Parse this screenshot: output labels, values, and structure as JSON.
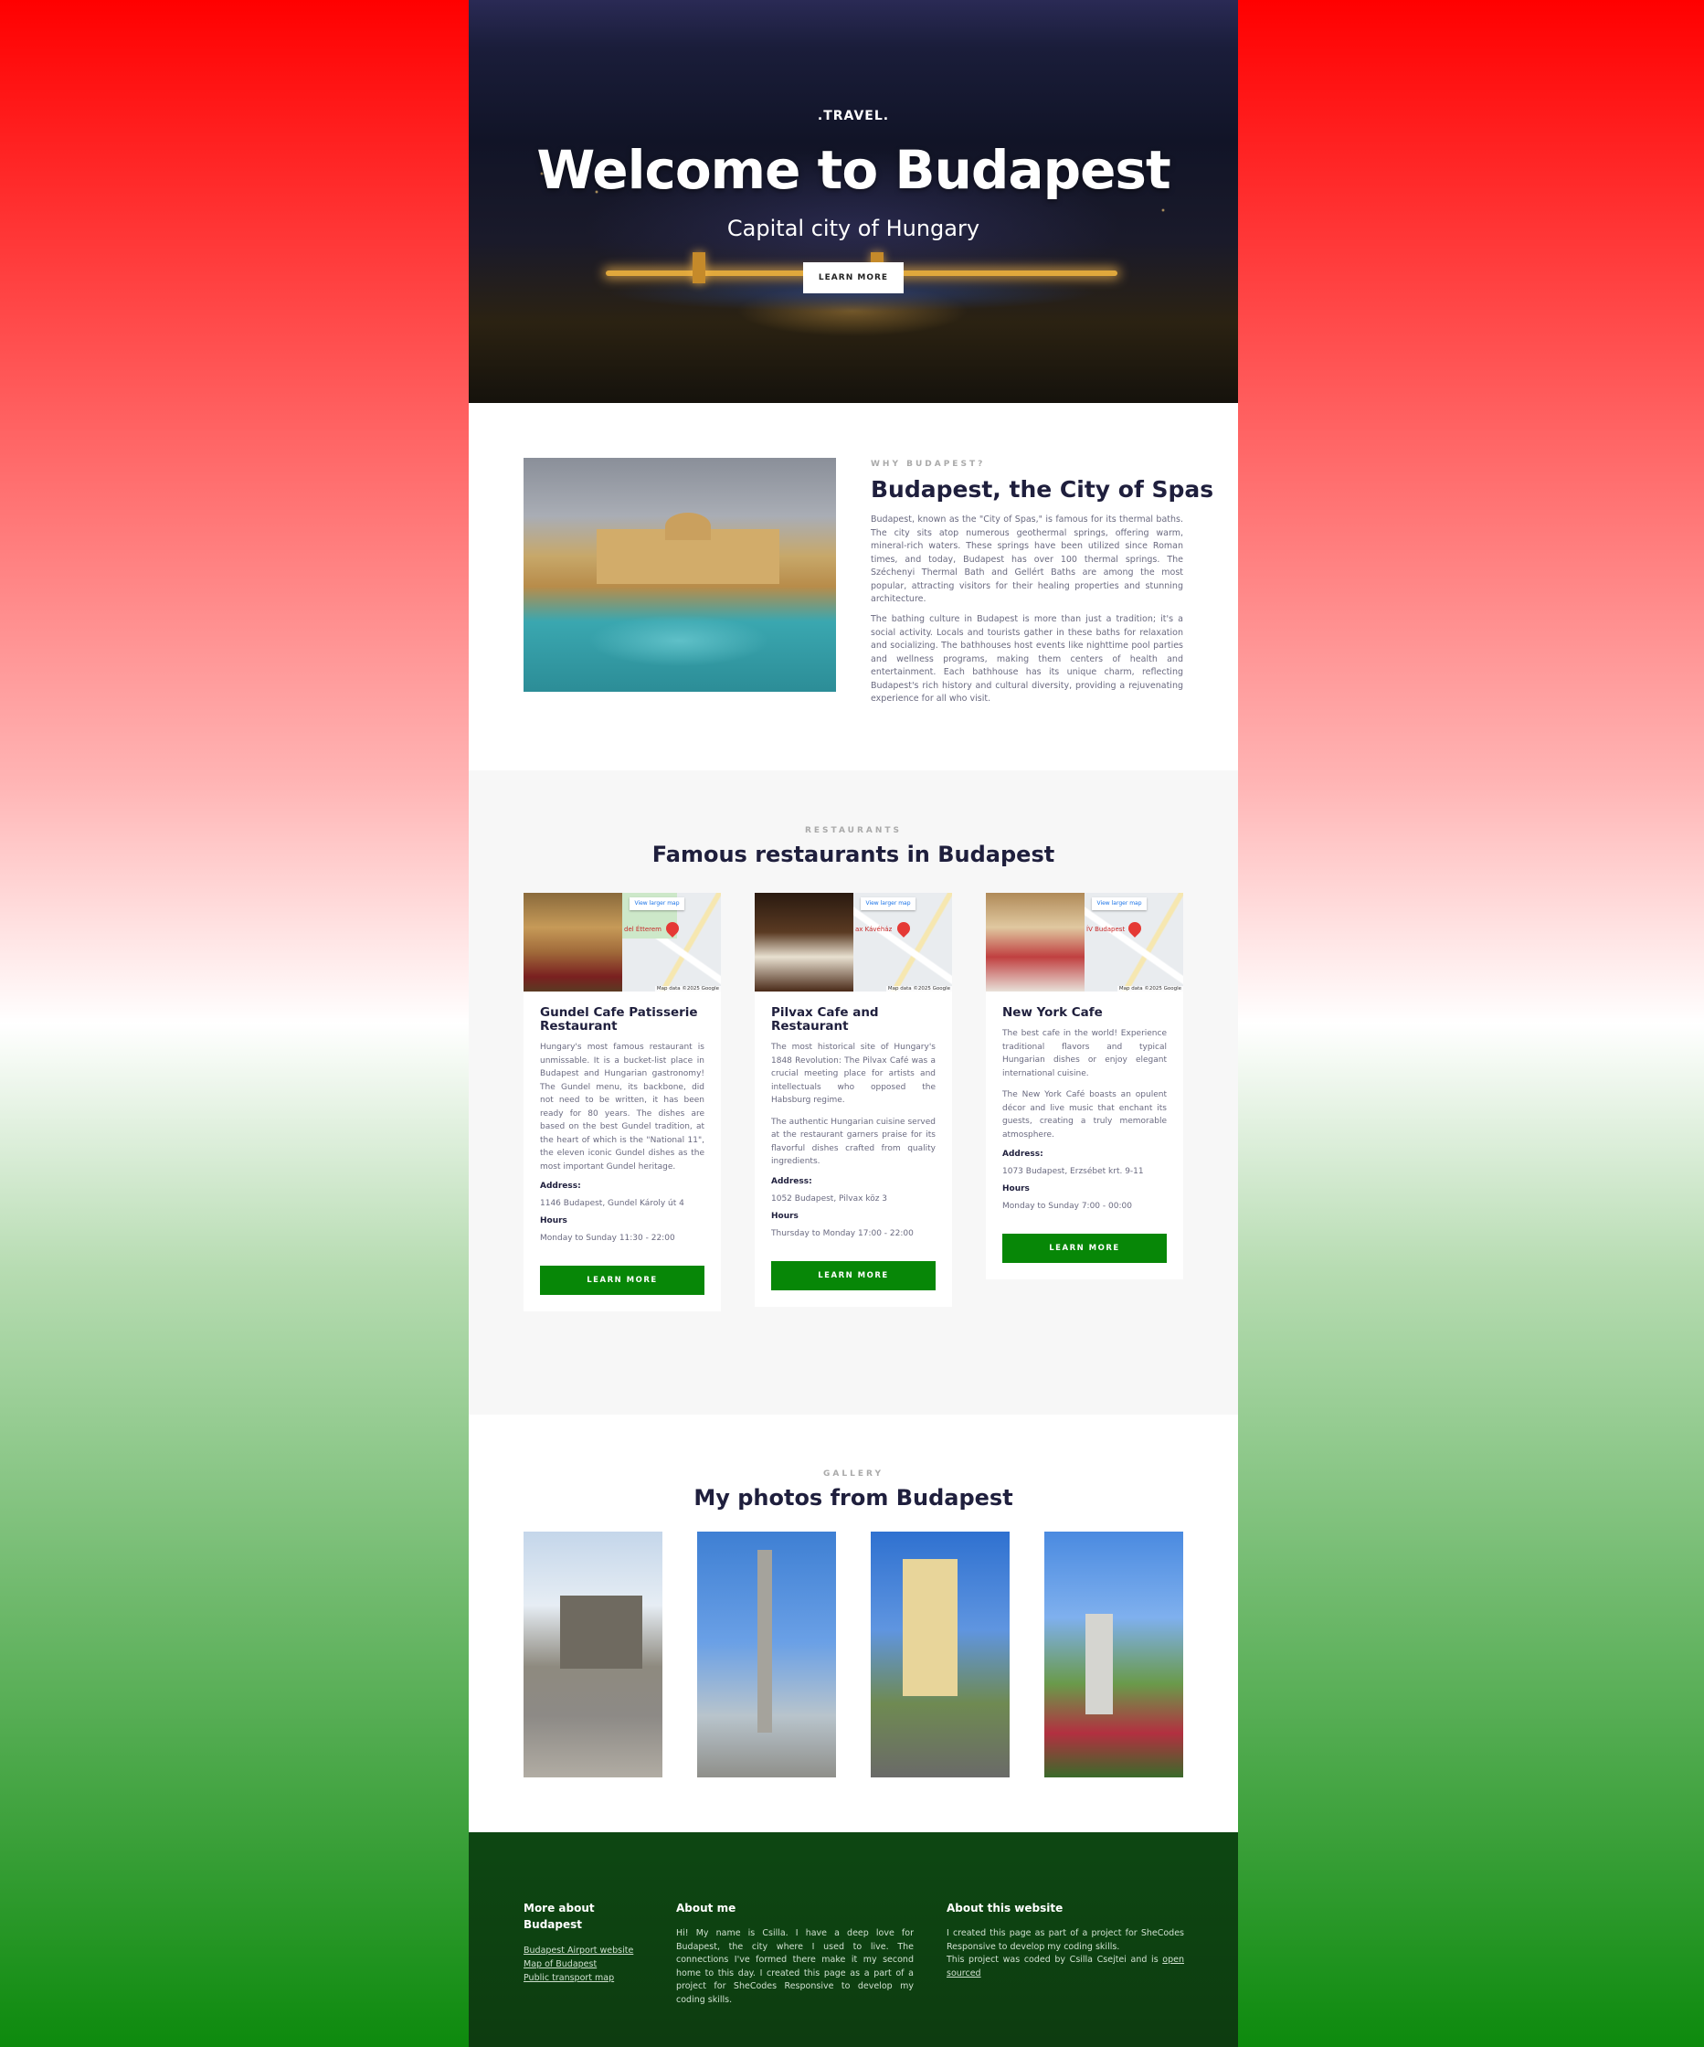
{
  "hero": {
    "brand": ".TRAVEL.",
    "title": "Welcome to Budapest",
    "subtitle": "Capital city of Hungary",
    "button": "LEARN MORE"
  },
  "about": {
    "kicker": "WHY BUDAPEST?",
    "title": "Budapest, the City of Spas",
    "paragraphs": [
      "Budapest, known as the \"City of Spas,\" is famous for its thermal baths. The city sits atop numerous geothermal springs, offering warm, mineral-rich waters. These springs have been utilized since Roman times, and today, Budapest has over 100 thermal springs. The Széchenyi Thermal Bath and Gellért Baths are among the most popular, attracting visitors for their healing properties and stunning architecture.",
      "The bathing culture in Budapest is more than just a tradition; it's a social activity. Locals and tourists gather in these baths for relaxation and socializing. The bathhouses host events like nighttime pool parties and wellness programs, making them centers of health and entertainment. Each bathhouse has its unique charm, reflecting Budapest's rich history and cultural diversity, providing a rejuvenating experience for all who visit."
    ]
  },
  "restaurants": {
    "kicker": "RESTAURANTS",
    "title": "Famous restaurants in Budapest",
    "map_link": "View larger map",
    "map_data": "Map data ©2025 Google",
    "address_label": "Address:",
    "hours_label": "Hours",
    "button": "LEARN MORE",
    "cards": [
      {
        "name": "Gundel Cafe Patisserie Restaurant",
        "map_label": "del Étterem",
        "paragraphs": [
          "Hungary's most famous restaurant is unmissable. It is a bucket-list place in Budapest and Hungarian gastronomy! The Gundel menu, its backbone, did not need to be written, it has been ready for 80 years. The dishes are based on the best Gundel tradition, at the heart of which is the \"National 11\", the eleven iconic Gundel dishes as the most important Gundel heritage."
        ],
        "address": "1146 Budapest, Gundel Károly út 4",
        "hours": "Monday to Sunday 11:30 - 22:00"
      },
      {
        "name": "Pilvax Cafe and Restaurant",
        "map_label": "ax Kávéház",
        "paragraphs": [
          "The most historical site of Hungary's 1848 Revolution: The Pilvax Café was a crucial meeting place for artists and intellectuals who opposed the Habsburg regime.",
          "The authentic Hungarian cuisine served at the restaurant garners praise for its flavorful dishes crafted from quality ingredients."
        ],
        "address": "1052 Budapest, Pilvax köz 3",
        "hours": "Thursday to Monday 17:00 - 22:00"
      },
      {
        "name": "New York Cafe",
        "map_label": "ÍV Budapest",
        "paragraphs": [
          "The best cafe in the world! Experience traditional flavors and typical Hungarian dishes or enjoy elegant international cuisine.",
          "The New York Café boasts an opulent décor and live music that enchant its guests, creating a truly memorable atmosphere."
        ],
        "address": "1073 Budapest, Erzsébet krt. 9-11",
        "hours": "Monday to Sunday 7:00 - 00:00"
      }
    ]
  },
  "gallery": {
    "kicker": "GALLERY",
    "title": "My photos from Budapest"
  },
  "footer": {
    "col1_title": "More about Budapest",
    "links": [
      "Budapest Airport website",
      "Map of Budapest",
      "Public transport map"
    ],
    "col2_title": "About me",
    "about_me": "Hi! My name is Csilla. I have a deep love for Budapest, the city where I used to live. The connections I've formed there make it my second home to this day. I created this page as a part of a project for SheCodes Responsive to develop my coding skills.",
    "col3_title": "About this website",
    "about_site_1": "I created this page as part of a project for SheCodes Responsive to develop my coding skills.",
    "about_site_2": "This project was coded by Csilla Csejtei and is ",
    "about_site_link": "open sourced"
  }
}
